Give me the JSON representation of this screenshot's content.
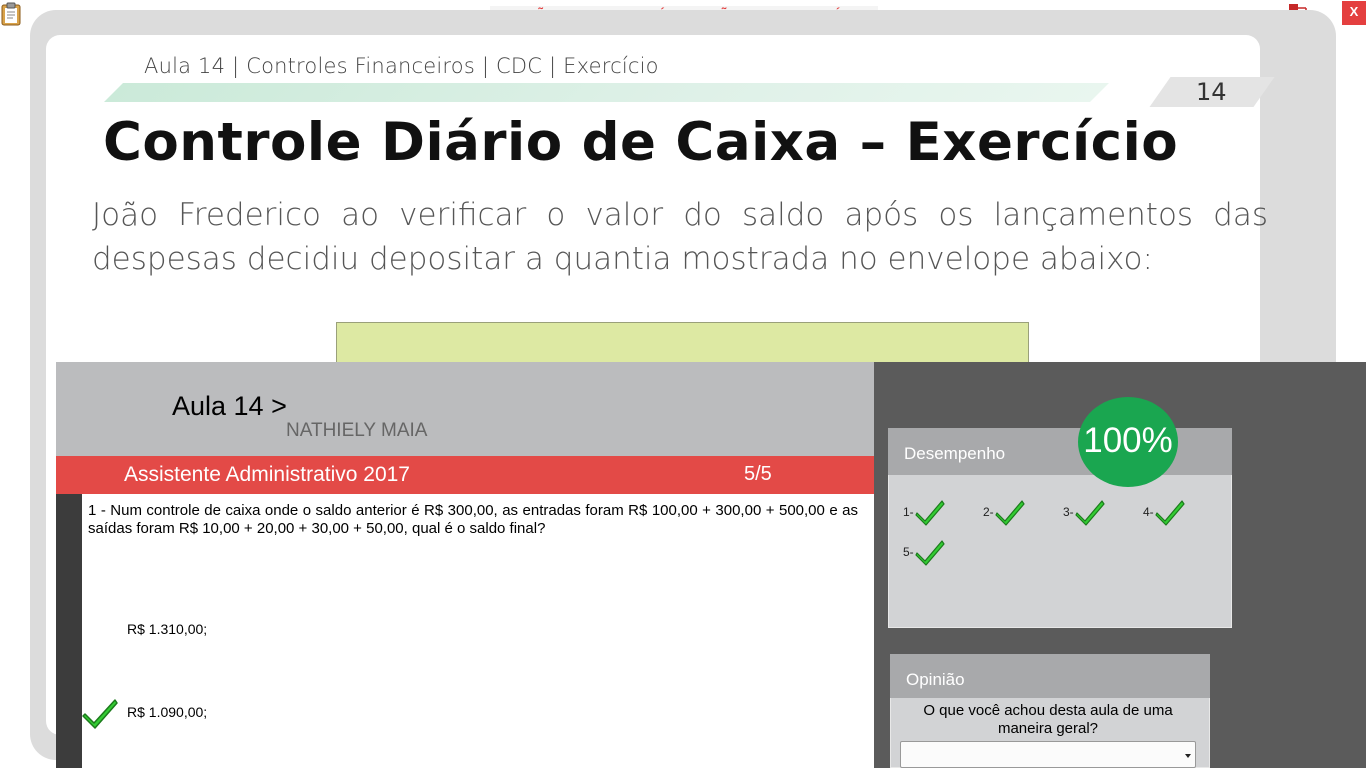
{
  "topbar": {
    "banner_text": "VERSÃO PARA FUNCIONÁRIOS - NÃO COMERCIALIZÁVEL",
    "close_label": "X",
    "left_icon": "clipboard-icon",
    "right_icon": "network-status-icon"
  },
  "slide": {
    "breadcrumb": "Aula 14 | Controles Financeiros | CDC | Exercício",
    "page_number": "14",
    "title": "Controle Diário de Caixa – Exercício",
    "body": "João Frederico ao verificar o valor do saldo após os lançamentos das despesas decidiu depositar a quantia mostrada no envelope abaixo:"
  },
  "lesson": {
    "title": "Aula 14 >",
    "user": "NATHIELY MAIA",
    "course": "Assistente Administrativo 2017",
    "progress": "5/5",
    "question": "1 - Num controle de caixa onde o saldo anterior é R$ 300,00, as entradas foram R$ 100,00 + 300,00 + 500,00 e as saídas foram R$ 10,00 + 20,00 + 30,00 + 50,00, qual é o saldo final?",
    "options": [
      "R$ 1.310,00;",
      "R$ 1.090,00;"
    ],
    "selected_option_icon": "check-icon"
  },
  "performance": {
    "label": "Desempenho",
    "score": "100%",
    "items": [
      {
        "label": "1-",
        "status": "correct"
      },
      {
        "label": "2-",
        "status": "correct"
      },
      {
        "label": "3-",
        "status": "correct"
      },
      {
        "label": "4-",
        "status": "correct"
      },
      {
        "label": "5-",
        "status": "correct"
      }
    ]
  },
  "opinion": {
    "label": "Opinião",
    "question": "O que você achou desta aula de uma maneira geral?",
    "select_value": ""
  },
  "colors": {
    "accent_red": "#e34a47",
    "score_green": "#1aa650",
    "check_green": "#33cc33",
    "dark_panel": "#5b5b5b",
    "envelope": "#dde9a3"
  }
}
